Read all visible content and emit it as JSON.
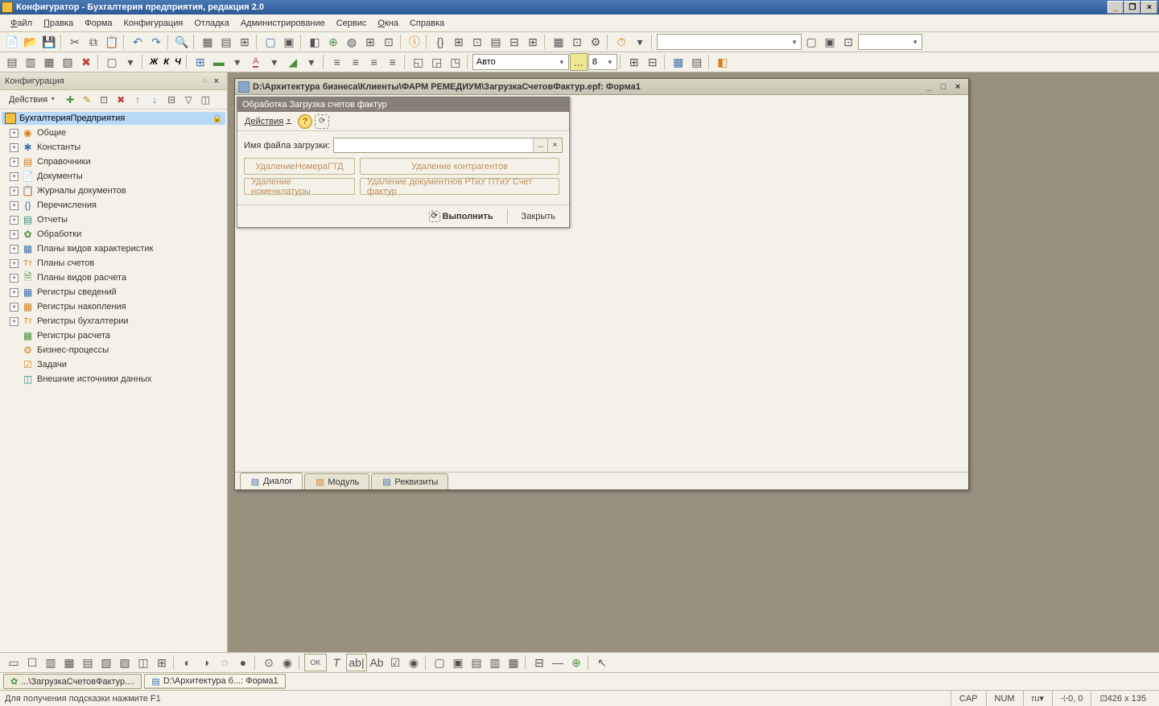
{
  "app": {
    "title": "Конфигуратор - Бухгалтерия предприятия, редакция 2.0"
  },
  "menu": {
    "file": "Файл",
    "edit": "Правка",
    "form": "Форма",
    "config": "Конфигурация",
    "debug": "Отладка",
    "admin": "Администрирование",
    "service": "Сервис",
    "windows": "Окна",
    "help": "Справка"
  },
  "toolbar2": {
    "font_combo": "Авто",
    "size_combo": "8"
  },
  "config_panel": {
    "title": "Конфигурация",
    "actions": "Действия",
    "root": "БухгалтерияПредприятия",
    "items": [
      "Общие",
      "Константы",
      "Справочники",
      "Документы",
      "Журналы документов",
      "Перечисления",
      "Отчеты",
      "Обработки",
      "Планы видов характеристик",
      "Планы счетов",
      "Планы видов расчета",
      "Регистры сведений",
      "Регистры накопления",
      "Регистры бухгалтерии",
      "Регистры расчета",
      "Бизнес-процессы",
      "Задачи",
      "Внешние источники данных"
    ]
  },
  "doc": {
    "title": "D:\\Архитектура бизнеса\\Клиенты\\ФАРМ РЕМЕДИУМ\\ЗагрузкаСчетовФактур.epf: Форма1",
    "form_header": "Обработка  Загрузка счетов фактур",
    "form_actions": "Действия",
    "file_label": "Имя файла загрузки:",
    "btn_del_gtd": "УдалениеНомераГТД",
    "btn_del_contr": "Удаление контрагентов",
    "btn_del_nomen": "Удаление номенклатуры",
    "btn_del_docs": "Удаление документнов РТиУ ПТиУ Счет фактур",
    "btn_execute": "Выполнить",
    "btn_close": "Закрыть",
    "tab_dialog": "Диалог",
    "tab_module": "Модуль",
    "tab_props": "Реквизиты"
  },
  "taskbar": {
    "item1": "...\\ЗагрузкаСчетовФактур....",
    "item2": "D:\\Архитектура б...: Форма1"
  },
  "status": {
    "hint": "Для получения подсказки нажмите F1",
    "cap": "CAP",
    "num": "NUM",
    "lang": "ru",
    "coords": "0, 0",
    "size": "426 x 135"
  }
}
